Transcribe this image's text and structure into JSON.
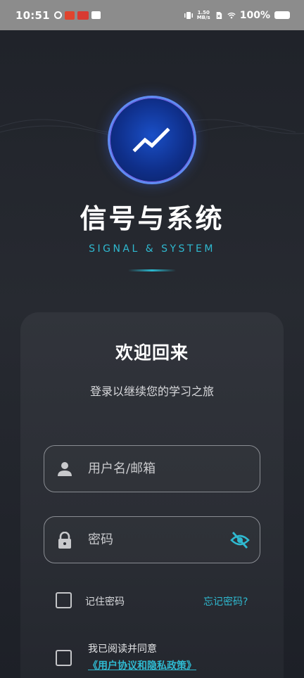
{
  "status_bar": {
    "time": "10:51",
    "net_speed_top": "1.50",
    "net_speed_bottom": "MB/s",
    "battery": "100%"
  },
  "app": {
    "title": "信号与系统",
    "subtitle": "SIGNAL & SYSTEM"
  },
  "login": {
    "welcome": "欢迎回来",
    "welcome_sub": "登录以继续您的学习之旅",
    "username_placeholder": "用户名/邮箱",
    "password_placeholder": "密码",
    "remember_label": "记住密码",
    "forgot_label": "忘记密码?",
    "agree_text": "我已阅读并同意",
    "agree_link": "《用户协议和隐私政策》"
  },
  "colors": {
    "accent": "#2fb9d0",
    "status_bar": "#8c8c8c",
    "background": "#23262d"
  },
  "icons": {
    "logo": "trend-line-icon",
    "username": "person-icon",
    "password": "lock-icon",
    "visibility": "eye-off-icon"
  }
}
